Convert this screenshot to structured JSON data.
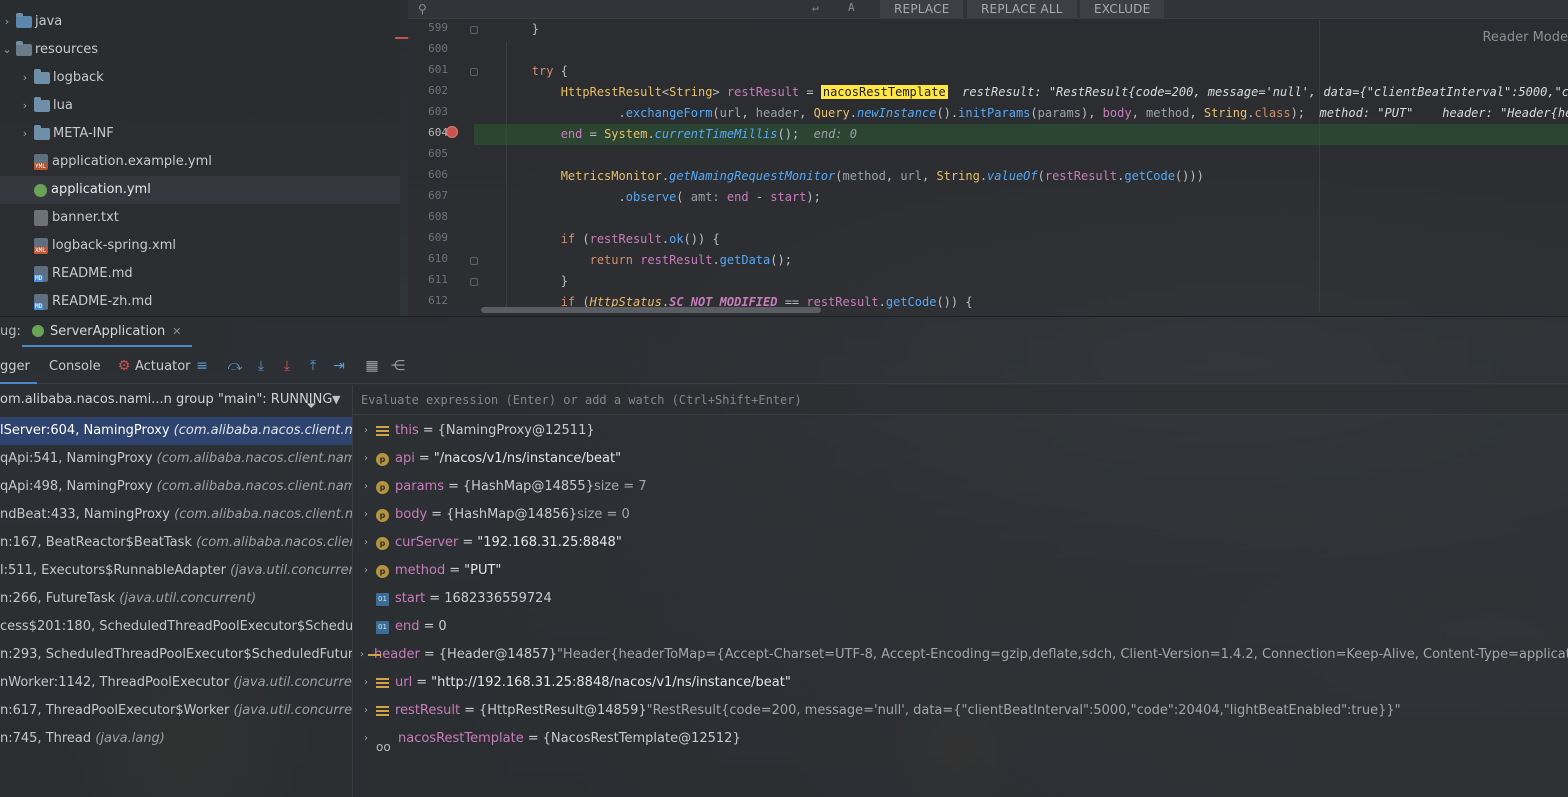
{
  "tree": {
    "items": [
      {
        "label": "java",
        "kind": "src-folder",
        "expanded": false
      },
      {
        "label": "resources",
        "kind": "res-folder",
        "expanded": true
      },
      {
        "label": "logback",
        "kind": "folder",
        "expanded": false
      },
      {
        "label": "lua",
        "kind": "folder",
        "expanded": false
      },
      {
        "label": "META-INF",
        "kind": "folder",
        "expanded": false
      },
      {
        "label": "application.example.yml",
        "kind": "yml"
      },
      {
        "label": "application.yml",
        "kind": "spring"
      },
      {
        "label": "banner.txt",
        "kind": "txt"
      },
      {
        "label": "logback-spring.xml",
        "kind": "xml"
      },
      {
        "label": "README.md",
        "kind": "md"
      },
      {
        "label": "README-zh.md",
        "kind": "md"
      }
    ]
  },
  "findbar": {
    "replace_label": "REPLACE",
    "replace_all_label": "REPLACE ALL",
    "exclude_label": "EXCLUDE",
    "regex_hint": "A"
  },
  "editor": {
    "reader_mode": "Reader Mode",
    "lines": [
      {
        "n": "599"
      },
      {
        "n": "600"
      },
      {
        "n": "601"
      },
      {
        "n": "602"
      },
      {
        "n": "603"
      },
      {
        "n": "604"
      },
      {
        "n": "605"
      },
      {
        "n": "606"
      },
      {
        "n": "607"
      },
      {
        "n": "608"
      },
      {
        "n": "609"
      },
      {
        "n": "610"
      },
      {
        "n": "611"
      },
      {
        "n": "612"
      }
    ],
    "current_line": "604",
    "highlight_word": "nacosRestTemplate",
    "inline_hints": {
      "restResult": "restResult: \"RestResult{code=200, message='null', data={\"clientBeatInterval\":5000,\"code\"",
      "method_header": "method: \"PUT\"    header: \"Header{header",
      "end": "end: 0"
    }
  },
  "debug": {
    "panel_label": "ug:",
    "session_tab": "ServerApplication",
    "tabs": {
      "debugger": "gger",
      "console": "Console",
      "actuator": "Actuator"
    },
    "thread_filter": "om.alibaba.nacos.nami...n group \"main\": RUNNING",
    "eval_placeholder": "Evaluate expression (Enter) or add a watch (Ctrl+Shift+Enter)",
    "frames": [
      {
        "method": "lServer:604, NamingProxy ",
        "pkg": "(com.alibaba.nacos.client.naming.n",
        "selected": true
      },
      {
        "method": "qApi:541, NamingProxy ",
        "pkg": "(com.alibaba.nacos.client.naming.net",
        "selected": false
      },
      {
        "method": "qApi:498, NamingProxy ",
        "pkg": "(com.alibaba.nacos.client.naming.net",
        "selected": false
      },
      {
        "method": "ndBeat:433, NamingProxy ",
        "pkg": "(com.alibaba.nacos.client.naming.n",
        "selected": false
      },
      {
        "method": "n:167, BeatReactor$BeatTask ",
        "pkg": "(com.alibaba.nacos.client.namin",
        "selected": false
      },
      {
        "method": "l:511, Executors$RunnableAdapter ",
        "pkg": "(java.util.concurrent)",
        "selected": false
      },
      {
        "method": "n:266, FutureTask ",
        "pkg": "(java.util.concurrent)",
        "selected": false
      },
      {
        "method": "cess$201:180, ScheduledThreadPoolExecutor$ScheduledFutur",
        "pkg": "",
        "selected": false
      },
      {
        "method": "n:293, ScheduledThreadPoolExecutor$ScheduledFutureTask ",
        "pkg": "(j",
        "selected": false
      },
      {
        "method": "nWorker:1142, ThreadPoolExecutor ",
        "pkg": "(java.util.concurrent)",
        "selected": false
      },
      {
        "method": "n:617, ThreadPoolExecutor$Worker ",
        "pkg": "(java.util.concurrent)",
        "selected": false
      },
      {
        "method": "n:745, Thread ",
        "pkg": "(java.lang)",
        "selected": false
      }
    ],
    "variables": [
      {
        "expandable": true,
        "icon": "lines",
        "name": "this",
        "value": "{NamingProxy@12511}",
        "extra": ""
      },
      {
        "expandable": true,
        "icon": "p",
        "name": "api",
        "value": "\"/nacos/v1/ns/instance/beat\"",
        "extra": ""
      },
      {
        "expandable": true,
        "icon": "p",
        "name": "params",
        "value": "{HashMap@14855}",
        "extra": "  size = 7"
      },
      {
        "expandable": true,
        "icon": "p",
        "name": "body",
        "value": "{HashMap@14856}",
        "extra": "  size = 0"
      },
      {
        "expandable": true,
        "icon": "p",
        "name": "curServer",
        "value": "\"192.168.31.25:8848\"",
        "extra": ""
      },
      {
        "expandable": true,
        "icon": "p",
        "name": "method",
        "value": "\"PUT\"",
        "extra": ""
      },
      {
        "expandable": false,
        "icon": "o1",
        "name": "start",
        "value": "1682336559724",
        "extra": ""
      },
      {
        "expandable": false,
        "icon": "o1",
        "name": "end",
        "value": "0",
        "extra": ""
      },
      {
        "expandable": true,
        "icon": "lines",
        "name": "header",
        "value": "{Header@14857}",
        "extra": " \"Header{headerToMap={Accept-Charset=UTF-8, Accept-Encoding=gzip,deflate,sdch, Client-Version=1.4.2, Connection=Keep-Alive, Content-Type=application/x-www-form-urle"
      },
      {
        "expandable": true,
        "icon": "lines",
        "name": "url",
        "value": "\"http://192.168.31.25:8848/nacos/v1/ns/instance/beat\"",
        "extra": ""
      },
      {
        "expandable": true,
        "icon": "lines",
        "name": "restResult",
        "value": "{HttpRestResult@14859}",
        "extra": " \"RestResult{code=200, message='null', data={\"clientBeatInterval\":5000,\"code\":20404,\"lightBeatEnabled\":true}}\""
      },
      {
        "expandable": true,
        "icon": "glasses",
        "name": "nacosRestTemplate",
        "value": "{NacosRestTemplate@12512}",
        "extra": ""
      }
    ]
  }
}
